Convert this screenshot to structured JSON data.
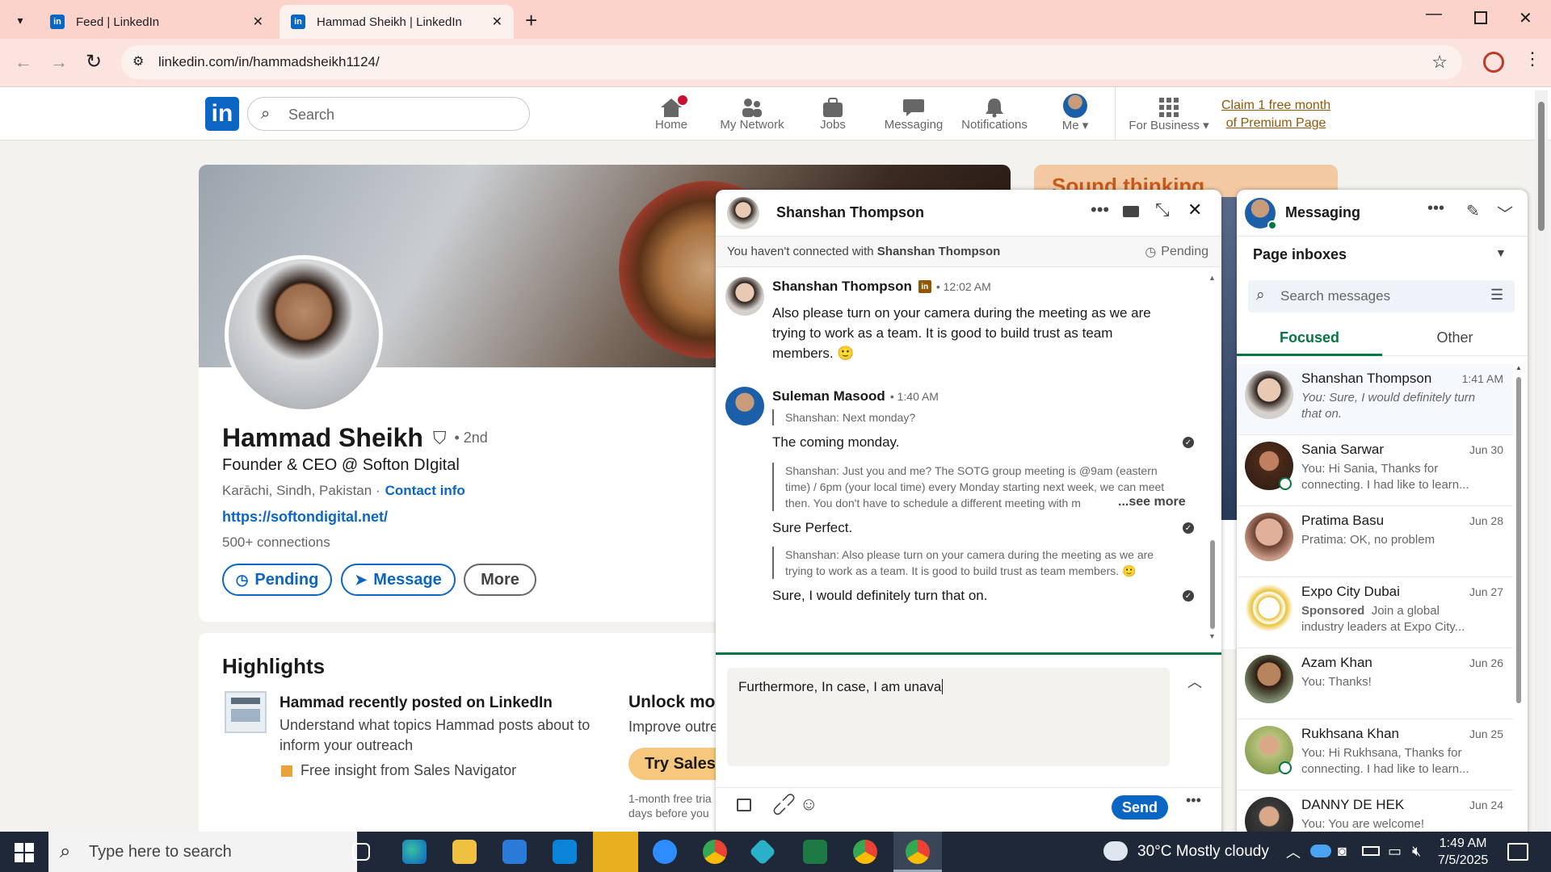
{
  "browser": {
    "tabs": [
      {
        "title": "Feed | LinkedIn"
      },
      {
        "title": "Hammad Sheikh | LinkedIn"
      }
    ],
    "url": "linkedin.com/in/hammadsheikh1124/"
  },
  "linkedin_nav": {
    "search_placeholder": "Search",
    "items": [
      {
        "label": "Home",
        "icon": "home-icon"
      },
      {
        "label": "My Network",
        "icon": "network-icon"
      },
      {
        "label": "Jobs",
        "icon": "briefcase-icon"
      },
      {
        "label": "Messaging",
        "icon": "messaging-icon"
      },
      {
        "label": "Notifications",
        "icon": "bell-icon"
      },
      {
        "label": "Me ▾",
        "icon": "avatar"
      },
      {
        "label": "For Business ▾",
        "icon": "grid-icon"
      }
    ],
    "premium_line1": "Claim 1 free month",
    "premium_line2": "of Premium Page"
  },
  "profile": {
    "name": "Hammad Sheikh",
    "degree": "• 2nd",
    "headline": "Founder & CEO @ Softon DIgital",
    "location": "Karāchi, Sindh, Pakistan ·",
    "contact_info": "Contact info",
    "website": "https://softondigital.net/",
    "connections": "500+ connections",
    "buttons": {
      "pending": "Pending",
      "message": "Message",
      "more": "More"
    }
  },
  "highlights": {
    "title": "Highlights",
    "post_title": "Hammad recently posted on LinkedIn",
    "post_desc": "Understand what topics Hammad posts about to inform your outreach",
    "insight": "Free insight from Sales Navigator",
    "unlock_title": "Unlock more",
    "unlock_desc": "Improve outre",
    "try_button": "Try Sales N",
    "trial_note_1": "1-month free tria",
    "trial_note_2": "days before you"
  },
  "side_ad": {
    "banner_text": "Sound thinking"
  },
  "conversation": {
    "contact_name": "Shanshan Thompson",
    "not_connected_prefix": "You haven't connected with",
    "not_connected_name": "Shanshan Thompson",
    "pending_label": "Pending",
    "messages": [
      {
        "sender": "Shanshan Thompson",
        "time": "• 12:02 AM",
        "text": "Also please turn on your camera during the meeting as we are trying to work as a team. It is good to build trust as team members. 🙂"
      },
      {
        "sender": "Suleman Masood",
        "time": "• 1:40 AM"
      }
    ],
    "replies": [
      {
        "quote": "Shanshan: Next monday?",
        "text": "The coming monday."
      },
      {
        "quote": "Shanshan: Just you and me? The SOTG group meeting is @9am (eastern time) / 6pm (your local time) every Monday starting next week, we can meet then. You don't have to schedule a different meeting with m",
        "see_more": "...see more",
        "text": "Sure Perfect."
      },
      {
        "quote": "Shanshan: Also please turn on your camera during the meeting as we are trying to work as a team. It is good to build trust as team members. 🙂",
        "text": "Sure, I would definitely turn that on."
      }
    ],
    "draft": "Furthermore, In case, I am unava",
    "send_label": "Send"
  },
  "messaging": {
    "title": "Messaging",
    "inbox_label": "Page inboxes",
    "search_placeholder": "Search messages",
    "tabs": [
      "Focused",
      "Other"
    ],
    "conversations": [
      {
        "name": "Shanshan Thompson",
        "date": "1:41 AM",
        "snippet": "You: Sure, I would definitely turn that on.",
        "color": "#d9c7b8"
      },
      {
        "name": "Sania Sarwar",
        "date": "Jun 30",
        "snippet": "You: Hi Sania, Thanks for connecting. I had like to learn...",
        "color": "#4a2a1a"
      },
      {
        "name": "Pratima Basu",
        "date": "Jun 28",
        "snippet": "Pratima: OK, no problem",
        "color": "#c99a86"
      },
      {
        "name": "Expo City Dubai",
        "date": "Jun 27",
        "sponsored": "Sponsored",
        "snippet": "Join a global industry leaders at Expo City...",
        "color": "#e9c23a"
      },
      {
        "name": "Azam Khan",
        "date": "Jun 26",
        "snippet": "You: Thanks!",
        "color": "#7a5a45"
      },
      {
        "name": "Rukhsana Khan",
        "date": "Jun 25",
        "snippet": "You: Hi Rukhsana, Thanks for connecting. I had like to learn...",
        "color": "#b8c27a"
      },
      {
        "name": "DANNY DE HEK",
        "date": "Jun 24",
        "snippet": "You: You are welcome!",
        "color": "#3a3a3a"
      }
    ]
  },
  "taskbar": {
    "search_placeholder": "Type here to search",
    "weather": "30°C  Mostly cloudy",
    "time": "1:49 AM",
    "date": "7/5/2025"
  }
}
